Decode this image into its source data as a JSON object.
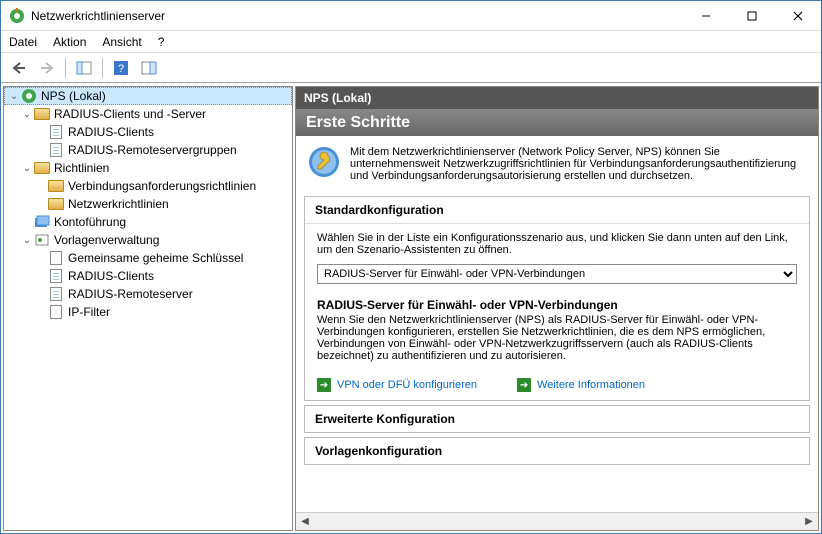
{
  "window": {
    "title": "Netzwerkrichtlinienserver"
  },
  "menu": {
    "items": [
      "Datei",
      "Aktion",
      "Ansicht",
      "?"
    ]
  },
  "tree": {
    "root": "NPS (Lokal)",
    "nodes": {
      "radius_clients_servers": "RADIUS-Clients und -Server",
      "radius_clients": "RADIUS-Clients",
      "radius_remote_groups": "RADIUS-Remoteservergruppen",
      "richtlinien": "Richtlinien",
      "verbindungsanforderung": "Verbindungsanforderungsrichtlinien",
      "netzwerkrichtlinien": "Netzwerkrichtlinien",
      "kontofuehrung": "Kontoführung",
      "vorlagenverwaltung": "Vorlagenverwaltung",
      "gemeinsame_geheime": "Gemeinsame geheime Schlüssel",
      "radius_clients2": "RADIUS-Clients",
      "radius_remoteserver": "RADIUS-Remoteserver",
      "ip_filter": "IP-Filter"
    }
  },
  "details": {
    "header": "NPS (Lokal)",
    "erste_schritte": "Erste Schritte",
    "intro": "Mit dem Netzwerkrichtlinienserver (Network Policy Server, NPS) können Sie unternehmensweit Netzwerkzugriffsrichtlinien für Verbindungsanforderungsauthentifizierung und Verbindungsanforderungsautorisierung erstellen und durchsetzen.",
    "standard_title": "Standardkonfiguration",
    "standard_instr": "Wählen Sie in der Liste ein Konfigurationsszenario aus, und klicken Sie dann unten auf den Link, um den Szenario-Assistenten zu öffnen.",
    "dropdown_value": "RADIUS-Server für Einwähl- oder VPN-Verbindungen",
    "scenario_heading": "RADIUS-Server für Einwähl- oder VPN-Verbindungen",
    "scenario_desc": "Wenn Sie den Netzwerkrichtlinienserver (NPS) als RADIUS-Server für Einwähl- oder VPN-Verbindungen konfigurieren, erstellen Sie Netzwerkrichtlinien, die es dem NPS ermöglichen, Verbindungen von Einwähl- oder VPN-Netzwerkzugriffsservern (auch als RADIUS-Clients bezeichnet) zu authentifizieren und zu autorisieren.",
    "link_configure": "VPN oder DFÜ konfigurieren",
    "link_more": "Weitere Informationen",
    "erweiterte": "Erweiterte Konfiguration",
    "vorlagen": "Vorlagenkonfiguration"
  }
}
